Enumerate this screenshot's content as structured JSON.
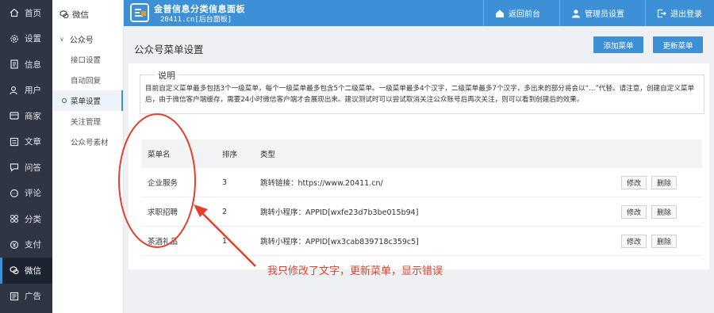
{
  "nav": {
    "items": [
      {
        "label": "首页",
        "icon": "home-icon"
      },
      {
        "label": "设置",
        "icon": "gear-icon"
      },
      {
        "label": "信息",
        "icon": "document-icon"
      },
      {
        "label": "用户",
        "icon": "user-icon"
      },
      {
        "label": "商家",
        "icon": "store-icon"
      },
      {
        "label": "文章",
        "icon": "article-icon"
      },
      {
        "label": "问答",
        "icon": "chat-icon"
      },
      {
        "label": "评论",
        "icon": "comment-icon"
      },
      {
        "label": "分类",
        "icon": "category-icon"
      },
      {
        "label": "支付",
        "icon": "pay-icon"
      },
      {
        "label": "微信",
        "icon": "wechat-icon",
        "active": true
      },
      {
        "label": "广告",
        "icon": "ad-icon"
      }
    ]
  },
  "subnav": {
    "head": "微信",
    "group": "公众号",
    "items": [
      "接口设置",
      "自动回复",
      "菜单设置",
      "关注管理",
      "公众号素材"
    ],
    "active": "菜单设置"
  },
  "topbar": {
    "title": "金普信息分类信息面板",
    "subtitle": "20411.cn[后台面板]",
    "back_label": "返回前台",
    "admin_label": "管理员设置",
    "logout_label": "退出登录"
  },
  "page": {
    "title": "公众号菜单设置",
    "add_button": "添加菜单",
    "update_button": "更新菜单"
  },
  "notice": {
    "legend": "说明",
    "text": "目前自定义菜单最多包括3个一级菜单，每个一级菜单最多包含5个二级菜单。一级菜单最多4个汉字，二级菜单最多7个汉字，多出来的部分将会以“...”代替。请注意，创建自定义菜单后，由于微信客户端缓存，需要24小时微信客户端才会展现出来。建议测试时可以尝试取消关注公众账号后再次关注，则可以看到创建后的效果。"
  },
  "table": {
    "headers": [
      "菜单名",
      "排序",
      "类型"
    ],
    "rows": [
      {
        "name": "企业服务",
        "order": "3",
        "type": "跳转链接：https://www.20411.cn/",
        "edit": "修改",
        "delete": "删除"
      },
      {
        "name": "求职招聘",
        "order": "2",
        "type": "跳转小程序：APPID[wxfe23d7b3be015b94]",
        "edit": "修改",
        "delete": "删除"
      },
      {
        "name": "茶酒礼品",
        "order": "1",
        "type": "跳转小程序：APPID[wx3cab839718c359c5]",
        "edit": "修改",
        "delete": "删除"
      }
    ]
  },
  "annotation": {
    "text": "我只修改了文字，更新菜单，显示错误",
    "color": "#e53e2c"
  },
  "colors": {
    "accent": "#3d8fd6",
    "nav_bg": "#2f3542"
  }
}
